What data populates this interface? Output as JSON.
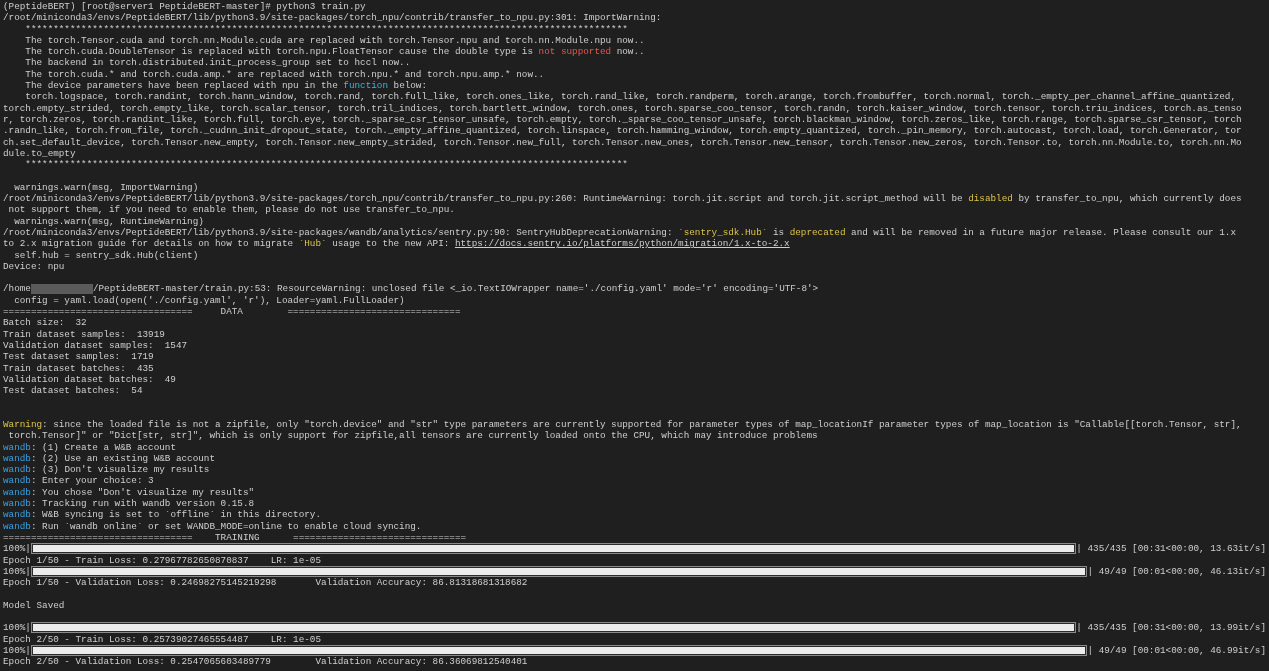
{
  "lines": [
    {
      "kind": "text",
      "segments": [
        {
          "kind": "plain",
          "text": "(PeptideBERT) [root@server1 PeptideBERT-master]# python3 train.py"
        }
      ]
    },
    {
      "kind": "text",
      "segments": [
        {
          "kind": "plain",
          "text": "/root/miniconda3/envs/PeptideBERT/lib/python3.9/site-packages/torch_npu/contrib/transfer_to_npu.py:301: ImportWarning:"
        }
      ]
    },
    {
      "kind": "text",
      "segments": [
        {
          "kind": "plain",
          "text": "    ************************************************************************************************************"
        }
      ]
    },
    {
      "kind": "text",
      "segments": [
        {
          "kind": "plain",
          "text": "    The torch.Tensor.cuda and torch.nn.Module.cuda are replaced with torch.Tensor.npu and torch.nn.Module.npu now.."
        }
      ]
    },
    {
      "kind": "text",
      "segments": [
        {
          "kind": "plain",
          "text": "    The torch.cuda.DoubleTensor is replaced with torch.npu.FloatTensor cause the double type is "
        },
        {
          "kind": "error",
          "text": "not supported"
        },
        {
          "kind": "plain",
          "text": " now.."
        }
      ]
    },
    {
      "kind": "text",
      "segments": [
        {
          "kind": "plain",
          "text": "    The backend in torch.distributed.init_process_group set to hccl now.."
        }
      ]
    },
    {
      "kind": "text",
      "segments": [
        {
          "kind": "plain",
          "text": "    The torch.cuda.* and torch.cuda.amp.* are replaced with torch.npu.* and torch.npu.amp.* now.."
        }
      ]
    },
    {
      "kind": "text",
      "segments": [
        {
          "kind": "plain",
          "text": "    The device parameters have been replaced with npu in the "
        },
        {
          "kind": "keyword",
          "text": "function"
        },
        {
          "kind": "plain",
          "text": " below:"
        }
      ]
    },
    {
      "kind": "text",
      "segments": [
        {
          "kind": "plain",
          "text": "    torch.logspace, torch.randint, torch.hann_window, torch.rand, torch.full_like, torch.ones_like, torch.rand_like, torch.randperm, torch.arange, torch.frombuffer, torch.normal, torch._empty_per_channel_affine_quantized,"
        }
      ]
    },
    {
      "kind": "text",
      "segments": [
        {
          "kind": "plain",
          "text": "torch.empty_strided, torch.empty_like, torch.scalar_tensor, torch.tril_indices, torch.bartlett_window, torch.ones, torch.sparse_coo_tensor, torch.randn, torch.kaiser_window, torch.tensor, torch.triu_indices, torch.as_tenso"
        }
      ]
    },
    {
      "kind": "text",
      "segments": [
        {
          "kind": "plain",
          "text": "r, torch.zeros, torch.randint_like, torch.full, torch.eye, torch._sparse_csr_tensor_unsafe, torch.empty, torch._sparse_coo_tensor_unsafe, torch.blackman_window, torch.zeros_like, torch.range, torch.sparse_csr_tensor, torch"
        }
      ]
    },
    {
      "kind": "text",
      "segments": [
        {
          "kind": "plain",
          "text": ".randn_like, torch.from_file, torch._cudnn_init_dropout_state, torch._empty_affine_quantized, torch.linspace, torch.hamming_window, torch.empty_quantized, torch._pin_memory, torch.autocast, torch.load, torch.Generator, tor"
        }
      ]
    },
    {
      "kind": "text",
      "segments": [
        {
          "kind": "plain",
          "text": "ch.set_default_device, torch.Tensor.new_empty, torch.Tensor.new_empty_strided, torch.Tensor.new_full, torch.Tensor.new_ones, torch.Tensor.new_tensor, torch.Tensor.new_zeros, torch.Tensor.to, torch.nn.Module.to, torch.nn.Mo"
        }
      ]
    },
    {
      "kind": "text",
      "segments": [
        {
          "kind": "plain",
          "text": "dule.to_empty"
        }
      ]
    },
    {
      "kind": "text",
      "segments": [
        {
          "kind": "plain",
          "text": "    ************************************************************************************************************"
        }
      ]
    },
    {
      "kind": "blank"
    },
    {
      "kind": "text",
      "segments": [
        {
          "kind": "plain",
          "text": "  warnings.warn(msg, ImportWarning)"
        }
      ]
    },
    {
      "kind": "text",
      "segments": [
        {
          "kind": "plain",
          "text": "/root/miniconda3/envs/PeptideBERT/lib/python3.9/site-packages/torch_npu/contrib/transfer_to_npu.py:260: RuntimeWarning: torch.jit.script and torch.jit.script_method will be "
        },
        {
          "kind": "warn",
          "text": "disabled"
        },
        {
          "kind": "plain",
          "text": " by transfer_to_npu, which currently does"
        }
      ]
    },
    {
      "kind": "text",
      "segments": [
        {
          "kind": "plain",
          "text": " not support them, if you need to enable them, please do not use transfer_to_npu."
        }
      ]
    },
    {
      "kind": "text",
      "segments": [
        {
          "kind": "plain",
          "text": "  warnings.warn(msg, RuntimeWarning)"
        }
      ]
    },
    {
      "kind": "text",
      "segments": [
        {
          "kind": "plain",
          "text": "/root/miniconda3/envs/PeptideBERT/lib/python3.9/site-packages/wandb/analytics/sentry.py:90: SentryHubDeprecationWarning: "
        },
        {
          "kind": "warn",
          "text": "`sentry_sdk.Hub`"
        },
        {
          "kind": "plain",
          "text": " is "
        },
        {
          "kind": "warn",
          "text": "deprecated"
        },
        {
          "kind": "plain",
          "text": " and will be removed in a future major release. Please consult our 1.x"
        }
      ]
    },
    {
      "kind": "text",
      "segments": [
        {
          "kind": "plain",
          "text": "to 2.x migration guide for details on how to migrate "
        },
        {
          "kind": "warn",
          "text": "`Hub`"
        },
        {
          "kind": "plain",
          "text": " usage to the new API: "
        },
        {
          "kind": "link",
          "text": "https://docs.sentry.io/platforms/python/migration/1.x-to-2.x"
        }
      ]
    },
    {
      "kind": "text",
      "segments": [
        {
          "kind": "plain",
          "text": "  self.hub = sentry_sdk.Hub(client)"
        }
      ]
    },
    {
      "kind": "text",
      "segments": [
        {
          "kind": "plain",
          "text": "Device: npu"
        }
      ]
    },
    {
      "kind": "blank"
    },
    {
      "kind": "text",
      "segments": [
        {
          "kind": "plain",
          "text": "/home"
        },
        {
          "kind": "redacted"
        },
        {
          "kind": "plain",
          "text": "/PeptideBERT-master/train.py:53: ResourceWarning: unclosed file <_io.TextIOWrapper name='./config.yaml' mode='r' encoding='UTF-8'>"
        }
      ]
    },
    {
      "kind": "text",
      "segments": [
        {
          "kind": "plain",
          "text": "  config = yaml.load(open('./config.yaml', 'r'), Loader=yaml.FullLoader)"
        }
      ]
    },
    {
      "kind": "text",
      "segments": [
        {
          "kind": "plain",
          "text": "==================================     DATA        ==============================="
        }
      ]
    },
    {
      "kind": "text",
      "segments": [
        {
          "kind": "plain",
          "text": "Batch size:  32"
        }
      ]
    },
    {
      "kind": "text",
      "segments": [
        {
          "kind": "plain",
          "text": "Train dataset samples:  13919"
        }
      ]
    },
    {
      "kind": "text",
      "segments": [
        {
          "kind": "plain",
          "text": "Validation dataset samples:  1547"
        }
      ]
    },
    {
      "kind": "text",
      "segments": [
        {
          "kind": "plain",
          "text": "Test dataset samples:  1719"
        }
      ]
    },
    {
      "kind": "text",
      "segments": [
        {
          "kind": "plain",
          "text": "Train dataset batches:  435"
        }
      ]
    },
    {
      "kind": "text",
      "segments": [
        {
          "kind": "plain",
          "text": "Validation dataset batches:  49"
        }
      ]
    },
    {
      "kind": "text",
      "segments": [
        {
          "kind": "plain",
          "text": "Test dataset batches:  54"
        }
      ]
    },
    {
      "kind": "blank"
    },
    {
      "kind": "blank"
    },
    {
      "kind": "text",
      "segments": [
        {
          "kind": "warn",
          "text": "Warning"
        },
        {
          "kind": "plain",
          "text": ": since the loaded file is not a zipfile, only \"torch.device\" and \"str\" type parameters are currently supported for parameter types of map_locationIf parameter types of map_location is \"Callable[[torch.Tensor, str],"
        }
      ]
    },
    {
      "kind": "text",
      "segments": [
        {
          "kind": "plain",
          "text": " torch.Tensor]\" or \"Dict[str, str]\", which is only support for zipfile,all tensors are currently loaded onto the CPU, which may introduce problems"
        }
      ]
    },
    {
      "kind": "text",
      "segments": [
        {
          "kind": "wandb",
          "text": "wandb"
        },
        {
          "kind": "plain",
          "text": ": (1) Create a W&B account"
        }
      ]
    },
    {
      "kind": "text",
      "segments": [
        {
          "kind": "wandb",
          "text": "wandb"
        },
        {
          "kind": "plain",
          "text": ": (2) Use an existing W&B account"
        }
      ]
    },
    {
      "kind": "text",
      "segments": [
        {
          "kind": "wandb",
          "text": "wandb"
        },
        {
          "kind": "plain",
          "text": ": (3) Don't visualize my results"
        }
      ]
    },
    {
      "kind": "text",
      "segments": [
        {
          "kind": "wandb",
          "text": "wandb"
        },
        {
          "kind": "plain",
          "text": ": Enter your choice: 3"
        }
      ]
    },
    {
      "kind": "text",
      "segments": [
        {
          "kind": "wandb",
          "text": "wandb"
        },
        {
          "kind": "plain",
          "text": ": You chose \"Don't visualize my results\""
        }
      ]
    },
    {
      "kind": "text",
      "segments": [
        {
          "kind": "wandb",
          "text": "wandb"
        },
        {
          "kind": "plain",
          "text": ": Tracking run with wandb version 0.15.8"
        }
      ]
    },
    {
      "kind": "text",
      "segments": [
        {
          "kind": "wandb",
          "text": "wandb"
        },
        {
          "kind": "plain",
          "text": ": W&B syncing is set to `offline` in this directory."
        }
      ]
    },
    {
      "kind": "text",
      "segments": [
        {
          "kind": "wandb",
          "text": "wandb"
        },
        {
          "kind": "plain",
          "text": ": Run `wandb online` or set WANDB_MODE=online to enable cloud syncing."
        }
      ]
    },
    {
      "kind": "text",
      "segments": [
        {
          "kind": "plain",
          "text": "==================================    TRAINING      ==============================="
        }
      ]
    },
    {
      "kind": "progress",
      "label": "100%|",
      "level": 1,
      "reading": "| 435/435 [00:31<00:00, 13.63it/s]"
    },
    {
      "kind": "text",
      "segments": [
        {
          "kind": "plain",
          "text": "Epoch 1/50 - Train Loss: 0.27967782650870837    LR: 1e-05"
        }
      ]
    },
    {
      "kind": "progress",
      "label": "100%|",
      "level": 1,
      "reading": "| 49/49 [00:01<00:00, 46.13it/s]"
    },
    {
      "kind": "text",
      "segments": [
        {
          "kind": "plain",
          "text": "Epoch 1/50 - Validation Loss: 0.24698275145219298       Validation Accuracy: 86.81318681318682"
        }
      ]
    },
    {
      "kind": "blank"
    },
    {
      "kind": "text",
      "segments": [
        {
          "kind": "plain",
          "text": "Model Saved"
        }
      ]
    },
    {
      "kind": "blank"
    },
    {
      "kind": "progress",
      "label": "100%|",
      "level": 1,
      "reading": "| 435/435 [00:31<00:00, 13.99it/s]"
    },
    {
      "kind": "text",
      "segments": [
        {
          "kind": "plain",
          "text": "Epoch 2/50 - Train Loss: 0.25739027465554487    LR: 1e-05"
        }
      ]
    },
    {
      "kind": "progress",
      "label": "100%|",
      "level": 1,
      "reading": "| 49/49 [00:01<00:00, 46.99it/s]"
    },
    {
      "kind": "text",
      "segments": [
        {
          "kind": "plain",
          "text": "Epoch 2/50 - Validation Loss: 0.2547065603489779        Validation Accuracy: 86.36069812540401"
        }
      ]
    }
  ]
}
